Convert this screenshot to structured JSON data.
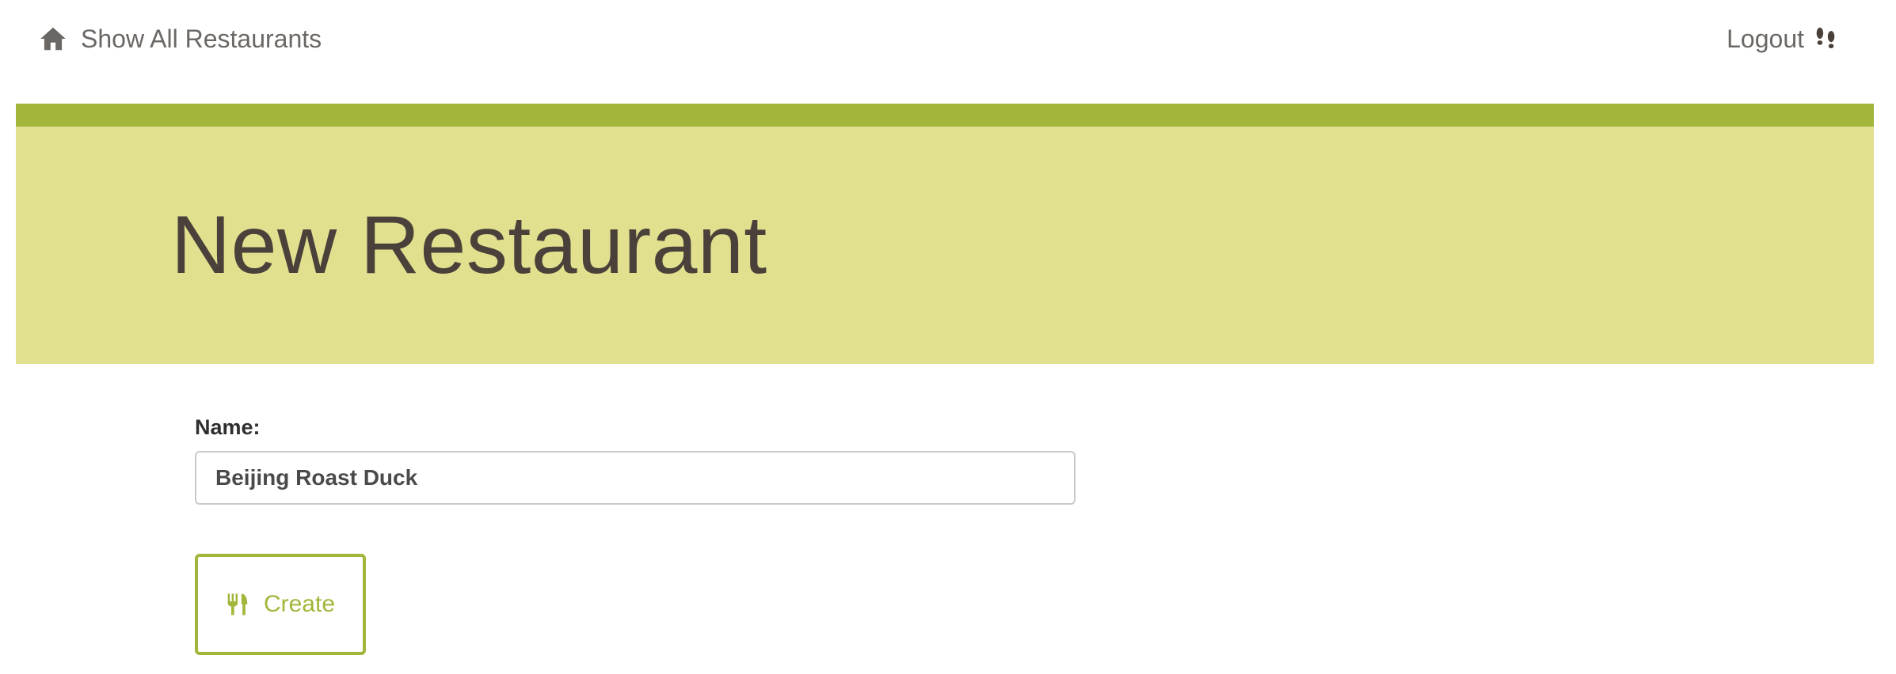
{
  "nav": {
    "home_label": "Show All Restaurants",
    "home_icon": "home-icon",
    "logout_label": "Logout",
    "logout_icon": "footprints-icon",
    "text_color": "#6b6764"
  },
  "hero": {
    "title": "New Restaurant",
    "bar_color": "#a3b53a",
    "bg_color": "#e1e08f",
    "title_color": "#4a413a"
  },
  "form": {
    "name_label": "Name:",
    "name_value": "Beijing Roast Duck",
    "submit_label": "Create",
    "submit_icon": "cutlery-icon",
    "accent_color": "#a3b53a"
  }
}
